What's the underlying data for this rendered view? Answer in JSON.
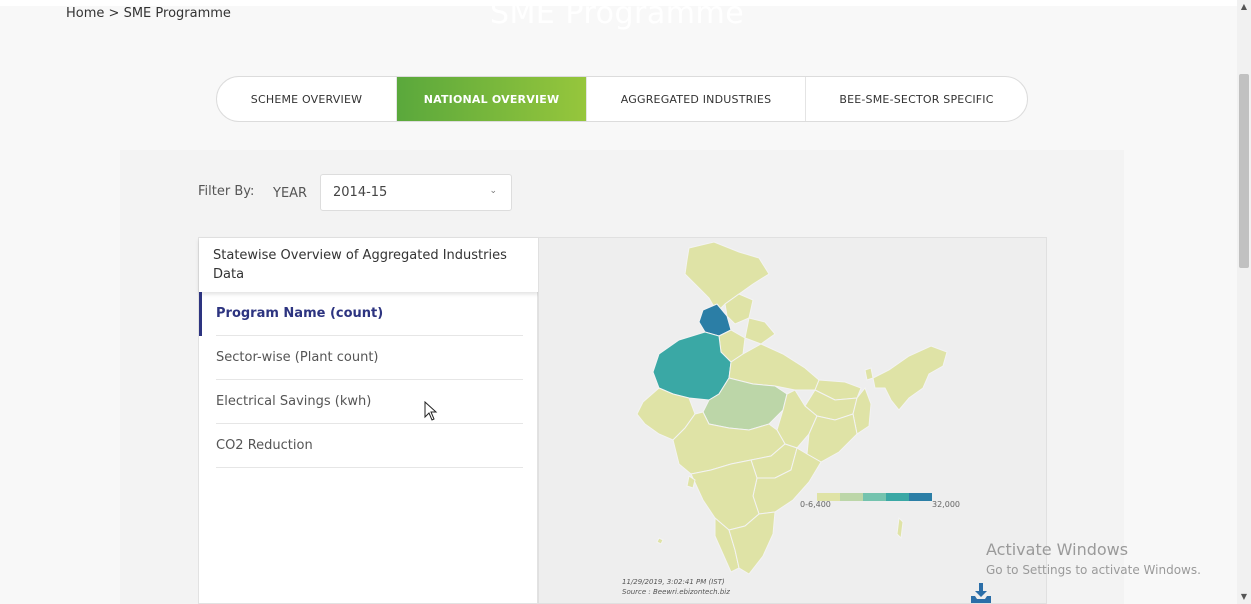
{
  "breadcrumb": {
    "home": "Home",
    "separator": ">",
    "current": "SME Programme"
  },
  "page_title": "SME Programme",
  "tabs": [
    {
      "label": "SCHEME OVERVIEW",
      "active": false
    },
    {
      "label": "NATIONAL OVERVIEW",
      "active": true
    },
    {
      "label": "AGGREGATED INDUSTRIES",
      "active": false
    },
    {
      "label": "BEE-SME-SECTOR SPECIFIC",
      "active": false
    }
  ],
  "filter": {
    "label": "Filter By:",
    "field": "YEAR",
    "value": "2014-15"
  },
  "panel": {
    "title": "Statewise Overview of Aggregated Industries Data",
    "menu": [
      {
        "label": "Program Name (count)",
        "active": true
      },
      {
        "label": "Sector-wise (Plant count)",
        "active": false
      },
      {
        "label": "Electrical Savings (kwh)",
        "active": false
      },
      {
        "label": "CO2 Reduction",
        "active": false
      }
    ]
  },
  "map": {
    "legend_min": "0-6,400",
    "legend_max": "32,000",
    "legend_colors": [
      "#dfe3a6",
      "#bcd6a8",
      "#74c3ae",
      "#3aa8a5",
      "#2b7ea6"
    ],
    "timestamp": "11/29/2019, 3:02:41 PM (IST)",
    "source": "Source : Beewri.ebizontech.biz",
    "download_icon": "download-icon"
  },
  "watermark": {
    "line1": "Activate Windows",
    "line2": "Go to Settings to activate Windows."
  }
}
